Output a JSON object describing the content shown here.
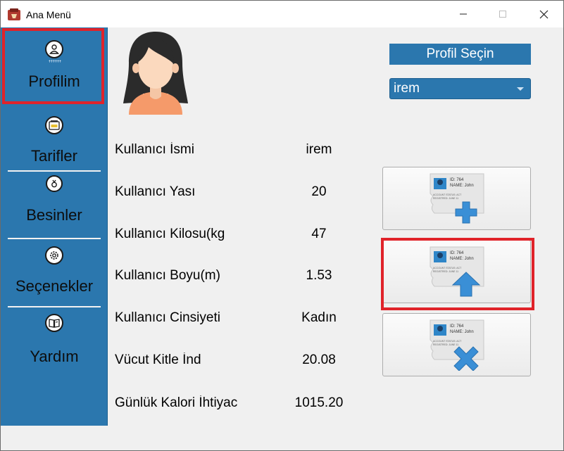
{
  "window": {
    "title": "Ana Menü",
    "minimize_glyph": "—",
    "maximize_glyph": "☐",
    "close_glyph": "✕"
  },
  "sidebar": {
    "items": [
      {
        "label": "Profilim",
        "icon": "user-icon"
      },
      {
        "label": "Tarifler",
        "icon": "recipe-icon"
      },
      {
        "label": "Besinler",
        "icon": "food-icon"
      },
      {
        "label": "Seçenekler",
        "icon": "gear-icon"
      },
      {
        "label": "Yardım",
        "icon": "book-icon"
      }
    ]
  },
  "profile": {
    "header": "Profil Seçin",
    "selected": "irem",
    "fields": [
      {
        "label": "Kullanıcı İsmi",
        "value": "irem"
      },
      {
        "label": "Kullanıcı Yası",
        "value": "20"
      },
      {
        "label": "Kullanıcı Kilosu(kg",
        "value": "47"
      },
      {
        "label": "Kullanıcı Boyu(m)",
        "value": "1.53"
      },
      {
        "label": "Kullanıcı Cinsiyeti",
        "value": "Kadın"
      },
      {
        "label": "Vücut Kitle İnd",
        "value": "20.08"
      },
      {
        "label": "Günlük Kalori İhtiyac",
        "value": "1015.20"
      }
    ]
  },
  "actions": {
    "card_id": "ID: 764",
    "card_name": "NAME: John",
    "card_status": "ACCOUNT STATUS: ACT",
    "card_registered": "REGISTRED: JUNE 11",
    "buttons": [
      {
        "name": "add-profile",
        "icon": "add-card-icon"
      },
      {
        "name": "update-profile",
        "icon": "update-card-icon"
      },
      {
        "name": "delete-profile",
        "icon": "delete-card-icon"
      }
    ]
  },
  "colors": {
    "sidebar": "#2b77ae",
    "highlight": "#e0232a",
    "accent": "#3a8fd6"
  }
}
